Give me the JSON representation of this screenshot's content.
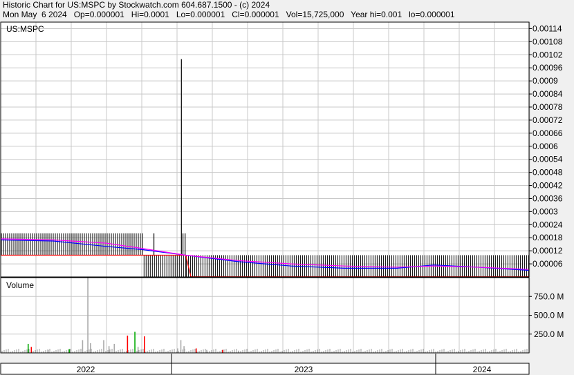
{
  "header": {
    "line1": "Historic Chart for US:MSPC by Stockwatch.com 604.687.1500 - (c) 2024",
    "line2": "Mon May  6 2024   Op=0.000001   Hi=0.0001   Lo=0.000001   Cl=0.000001   Vol=15,725,000   Year hi=0.001   lo=0.000001"
  },
  "chart_data": [
    {
      "type": "bar",
      "title": "US:MSPC",
      "ylim": [
        0,
        0.00117
      ],
      "y_ticks": [
        {
          "value": 0.00114,
          "label": "0.00114"
        },
        {
          "value": 0.00108,
          "label": "0.00108"
        },
        {
          "value": 0.00102,
          "label": "0.00102"
        },
        {
          "value": 0.00096,
          "label": "0.00096"
        },
        {
          "value": 0.0009,
          "label": "0.0009"
        },
        {
          "value": 0.00084,
          "label": "0.00084"
        },
        {
          "value": 0.00078,
          "label": "0.00078"
        },
        {
          "value": 0.00072,
          "label": "0.00072"
        },
        {
          "value": 0.00066,
          "label": "0.00066"
        },
        {
          "value": 0.0006,
          "label": "0.0006"
        },
        {
          "value": 0.00054,
          "label": "0.00054"
        },
        {
          "value": 0.00048,
          "label": "0.00048"
        },
        {
          "value": 0.00042,
          "label": "0.00042"
        },
        {
          "value": 0.00036,
          "label": "0.00036"
        },
        {
          "value": 0.0003,
          "label": "0.0003"
        },
        {
          "value": 0.00024,
          "label": "0.00024"
        },
        {
          "value": 0.00018,
          "label": "0.00018"
        },
        {
          "value": 0.00012,
          "label": "0.00012"
        },
        {
          "value": 6e-05,
          "label": "0.00006"
        }
      ],
      "grid": true,
      "x_labels": [
        "2022",
        "2023",
        "2024"
      ],
      "price_segments": [
        {
          "start": 0.0,
          "end": 0.27,
          "low": 0.0001,
          "high": 0.0002
        },
        {
          "start": 0.27,
          "end": 0.35,
          "low": 1e-06,
          "high": 0.0001
        },
        {
          "start": 0.35,
          "end": 1.0,
          "low": 1e-06,
          "high": 0.0001
        }
      ],
      "spikes": [
        {
          "pos": 0.29,
          "low": 0.0001,
          "high": 0.0002
        },
        {
          "pos": 0.342,
          "low": 0.0001,
          "high": 0.001
        },
        {
          "pos": 0.345,
          "low": 0.0001,
          "high": 0.0002
        },
        {
          "pos": 0.349,
          "low": 0.0001,
          "high": 0.0002
        }
      ],
      "ma_series": [
        {
          "color": "#ff0000",
          "points": [
            [
              0,
              0.0001
            ],
            [
              0.27,
              0.0001
            ],
            [
              0.27,
              0.0001
            ],
            [
              0.35,
              0.0001
            ],
            [
              0.36,
              1e-06
            ],
            [
              1.0,
              1e-06
            ]
          ]
        },
        {
          "color": "#0000ff",
          "points": [
            [
              0,
              0.00017
            ],
            [
              0.1,
              0.000165
            ],
            [
              0.2,
              0.00014
            ],
            [
              0.27,
              0.000125
            ],
            [
              0.35,
              0.0001
            ],
            [
              0.45,
              7e-05
            ],
            [
              0.55,
              5e-05
            ],
            [
              0.65,
              4e-05
            ],
            [
              0.75,
              4e-05
            ],
            [
              0.82,
              5.5e-05
            ],
            [
              0.9,
              4.5e-05
            ],
            [
              1.0,
              3e-05
            ]
          ]
        },
        {
          "color": "#ff00ff",
          "points": [
            [
              0,
              0.000175
            ],
            [
              0.1,
              0.00017
            ],
            [
              0.2,
              0.000155
            ],
            [
              0.27,
              0.00013
            ],
            [
              0.35,
              0.0001
            ],
            [
              0.45,
              7.5e-05
            ],
            [
              0.55,
              6e-05
            ],
            [
              0.65,
              5e-05
            ],
            [
              0.75,
              4.5e-05
            ],
            [
              0.82,
              5e-05
            ],
            [
              0.9,
              4.5e-05
            ],
            [
              1.0,
              3.5e-05
            ]
          ]
        }
      ]
    },
    {
      "type": "bar",
      "title": "Volume",
      "ylim": [
        0,
        1000000000
      ],
      "y_ticks": [
        {
          "value": 750000000,
          "label": "750.0 M"
        },
        {
          "value": 500000000,
          "label": "500.0 M"
        },
        {
          "value": 250000000,
          "label": "250.0 M"
        }
      ],
      "grid": true,
      "spikes": [
        {
          "pos": 0.052,
          "value": 120000000,
          "color": "#00aa00"
        },
        {
          "pos": 0.058,
          "value": 80000000,
          "color": "#ff0000"
        },
        {
          "pos": 0.09,
          "value": 40000000,
          "color": "#aaaaaa"
        },
        {
          "pos": 0.13,
          "value": 50000000,
          "color": "#00aa00"
        },
        {
          "pos": 0.155,
          "value": 170000000,
          "color": "#aaaaaa"
        },
        {
          "pos": 0.165,
          "value": 1000000000,
          "color": "#aaaaaa"
        },
        {
          "pos": 0.17,
          "value": 130000000,
          "color": "#aaaaaa"
        },
        {
          "pos": 0.195,
          "value": 170000000,
          "color": "#aaaaaa"
        },
        {
          "pos": 0.205,
          "value": 90000000,
          "color": "#aaaaaa"
        },
        {
          "pos": 0.215,
          "value": 120000000,
          "color": "#aaaaaa"
        },
        {
          "pos": 0.24,
          "value": 230000000,
          "color": "#ff0000"
        },
        {
          "pos": 0.254,
          "value": 280000000,
          "color": "#00aa00"
        },
        {
          "pos": 0.26,
          "value": 80000000,
          "color": "#aaaaaa"
        },
        {
          "pos": 0.272,
          "value": 220000000,
          "color": "#ff0000"
        },
        {
          "pos": 0.335,
          "value": 60000000,
          "color": "#aaaaaa"
        },
        {
          "pos": 0.341,
          "value": 170000000,
          "color": "#aaaaaa"
        },
        {
          "pos": 0.347,
          "value": 90000000,
          "color": "#aaaaaa"
        },
        {
          "pos": 0.37,
          "value": 60000000,
          "color": "#ff0000"
        },
        {
          "pos": 0.39,
          "value": 40000000,
          "color": "#aaaaaa"
        },
        {
          "pos": 0.42,
          "value": 40000000,
          "color": "#ff0000"
        },
        {
          "pos": 0.45,
          "value": 30000000,
          "color": "#aaaaaa"
        }
      ]
    }
  ]
}
